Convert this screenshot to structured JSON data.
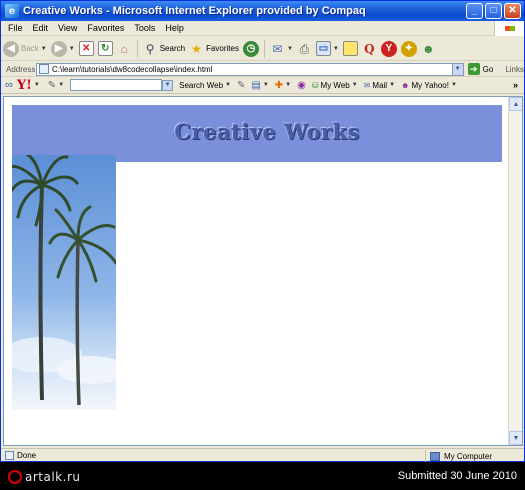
{
  "window": {
    "title": "Creative Works - Microsoft Internet Explorer provided by Compaq"
  },
  "menu": [
    "File",
    "Edit",
    "View",
    "Favorites",
    "Tools",
    "Help"
  ],
  "toolbar": {
    "back": "Back",
    "search": "Search",
    "favorites": "Favorites"
  },
  "address": {
    "label": "Address",
    "url": "C:\\learn\\tutorials\\dw8codecollapse\\index.html",
    "go": "Go",
    "links": "Links"
  },
  "yahoo": {
    "logo": "Y!",
    "search_web": "Search Web",
    "my_web": "My Web",
    "mail": "Mail",
    "my_yahoo": "My Yahoo!"
  },
  "page": {
    "title": "Creative Works"
  },
  "status": {
    "text": "Done",
    "zone": "My Computer"
  },
  "footer": {
    "brand": "artalk.ru",
    "submitted": "Submitted 30 June 2010"
  },
  "colors": {
    "header_bg": "#7B8FDA",
    "title_text": "#4B5FA6",
    "titlebar": "#0B4BD0"
  }
}
